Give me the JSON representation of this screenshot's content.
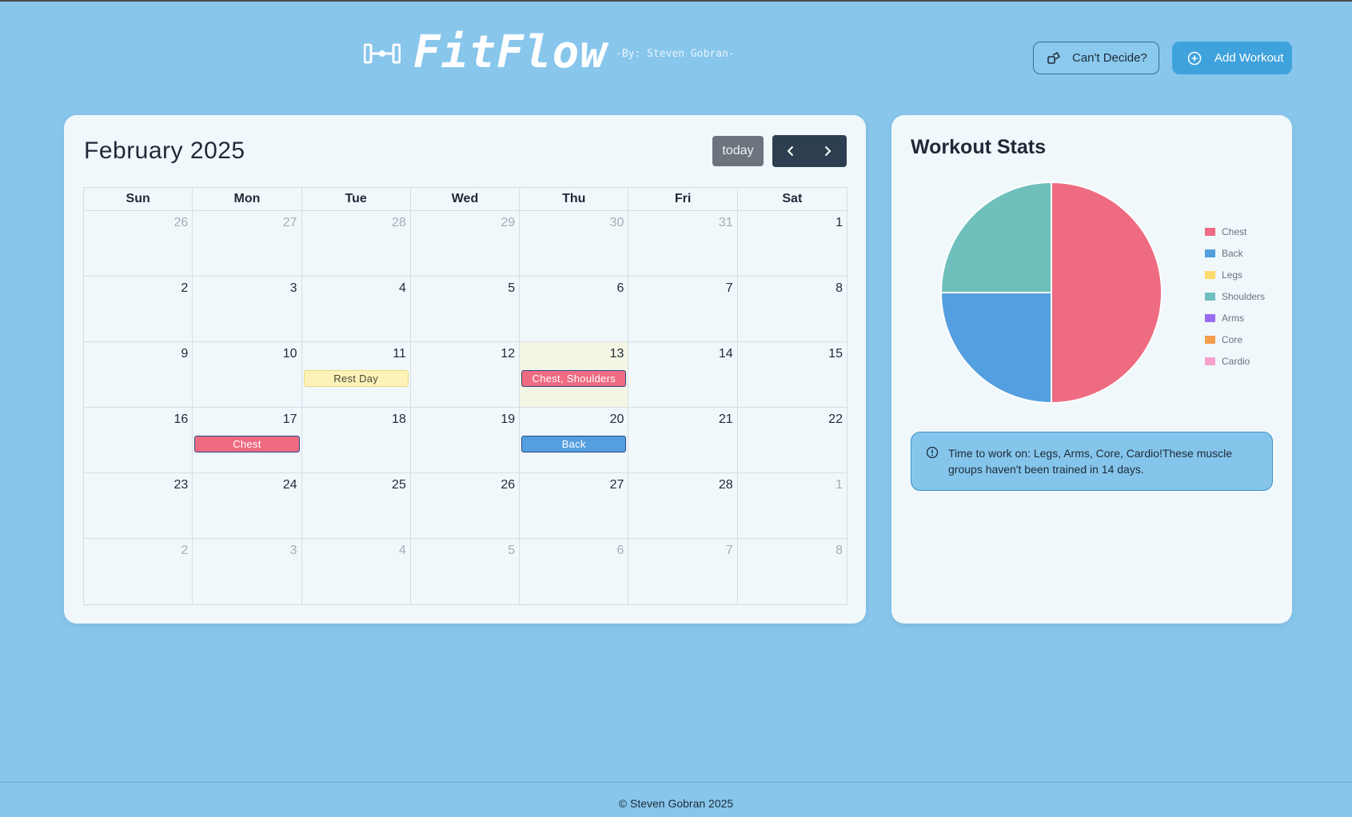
{
  "header": {
    "brand_name": "FitFlow",
    "brand_sub": "-By: Steven Gobran-",
    "decide_label": "Can't Decide?",
    "add_label": "Add Workout"
  },
  "calendar": {
    "title": "February 2025",
    "today_label": "today",
    "weekdays": [
      "Sun",
      "Mon",
      "Tue",
      "Wed",
      "Thu",
      "Fri",
      "Sat"
    ],
    "weeks": [
      [
        {
          "n": "26",
          "o": true
        },
        {
          "n": "27",
          "o": true
        },
        {
          "n": "28",
          "o": true
        },
        {
          "n": "29",
          "o": true
        },
        {
          "n": "30",
          "o": true
        },
        {
          "n": "31",
          "o": true
        },
        {
          "n": "1"
        }
      ],
      [
        {
          "n": "2"
        },
        {
          "n": "3"
        },
        {
          "n": "4"
        },
        {
          "n": "5"
        },
        {
          "n": "6"
        },
        {
          "n": "7"
        },
        {
          "n": "8"
        }
      ],
      [
        {
          "n": "9"
        },
        {
          "n": "10"
        },
        {
          "n": "11",
          "ev": "Rest Day",
          "evt": "rest"
        },
        {
          "n": "12"
        },
        {
          "n": "13",
          "today": true,
          "ev": "Chest, Shoulders",
          "evt": "chest"
        },
        {
          "n": "14"
        },
        {
          "n": "15"
        }
      ],
      [
        {
          "n": "16"
        },
        {
          "n": "17",
          "ev": "Chest",
          "evt": "chest"
        },
        {
          "n": "18"
        },
        {
          "n": "19"
        },
        {
          "n": "20",
          "ev": "Back",
          "evt": "back"
        },
        {
          "n": "21"
        },
        {
          "n": "22"
        }
      ],
      [
        {
          "n": "23"
        },
        {
          "n": "24"
        },
        {
          "n": "25"
        },
        {
          "n": "26"
        },
        {
          "n": "27"
        },
        {
          "n": "28"
        },
        {
          "n": "1",
          "o": true
        }
      ],
      [
        {
          "n": "2",
          "o": true
        },
        {
          "n": "3",
          "o": true
        },
        {
          "n": "4",
          "o": true
        },
        {
          "n": "5",
          "o": true
        },
        {
          "n": "6",
          "o": true
        },
        {
          "n": "7",
          "o": true
        },
        {
          "n": "8",
          "o": true
        }
      ]
    ]
  },
  "stats": {
    "title": "Workout Stats",
    "alert_text": "Time to work on: Legs, Arms, Core, Cardio!These muscle groups haven't been trained in 14 days."
  },
  "chart_data": {
    "type": "pie",
    "categories": [
      "Chest",
      "Back",
      "Legs",
      "Shoulders",
      "Arms",
      "Core",
      "Cardio"
    ],
    "values": [
      2,
      1,
      0,
      1,
      0,
      0,
      0
    ],
    "colors": [
      "#ee6b82",
      "#549fe0",
      "#fcd96a",
      "#6fbfbd",
      "#9b6cf0",
      "#f59e4c",
      "#f7a2cc"
    ],
    "legend_position": "right"
  },
  "footer": {
    "text": "© Steven Gobran 2025"
  }
}
